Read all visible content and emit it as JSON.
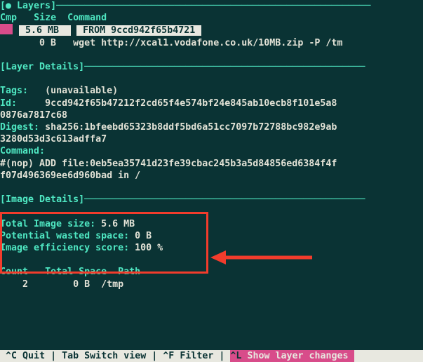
{
  "sections": {
    "layers_title": "● Layers",
    "layer_details_title": "Layer Details",
    "image_details_title": "Image Details"
  },
  "bracket_open": "[",
  "bracket_close": "]",
  "layers_header": {
    "cmp": "Cmp",
    "size": "Size",
    "command": "Command"
  },
  "layers": [
    {
      "size": "5.6 MB",
      "command": "FROM 9ccd942f65b4721",
      "selected": true
    },
    {
      "size": "0 B",
      "command": "wget http://xcal1.vodafone.co.uk/10MB.zip -P /tm",
      "selected": false
    }
  ],
  "details": {
    "tags_label": "Tags:",
    "tags_value": "(unavailable)",
    "id_label": "Id:",
    "id_value_l1": "9ccd942f65b47212f2cd65f4e574bf24e845ab10ecb8f101e5a8",
    "id_value_l2": "0876a7817c68",
    "digest_label": "Digest:",
    "digest_value_l1": "sha256:1bfeebd65323b8ddf5bd6a51cc7097b72788bc982e9ab",
    "digest_value_l2": "3280d53d3c613adffa7",
    "command_label": "Command:",
    "command_value_l1": "#(nop) ADD file:0eb5ea35741d23fe39cbac245b3a5d84856ed6384f4f",
    "command_value_l2": "f07d496369ee6d960bad in /"
  },
  "image": {
    "total_label": "Total Image size:",
    "total_value": "5.6 MB",
    "wasted_label": "Potential wasted space:",
    "wasted_value": "0 B",
    "eff_label": "Image efficiency score:",
    "eff_value": "100 %"
  },
  "table": {
    "count_h": "Count",
    "total_h": "Total",
    "space_h": "Space",
    "path_h": "Path",
    "row": {
      "count": "2",
      "total_space": "0 B",
      "path": "/tmp"
    }
  },
  "footer": {
    "quit_k": "^C",
    "quit_l": "Quit",
    "switch_k": "Tab",
    "switch_l": "Switch view",
    "filter_k": "^F",
    "filter_l": "Filter",
    "changes_k": "^L",
    "changes_l": "Show layer changes"
  }
}
